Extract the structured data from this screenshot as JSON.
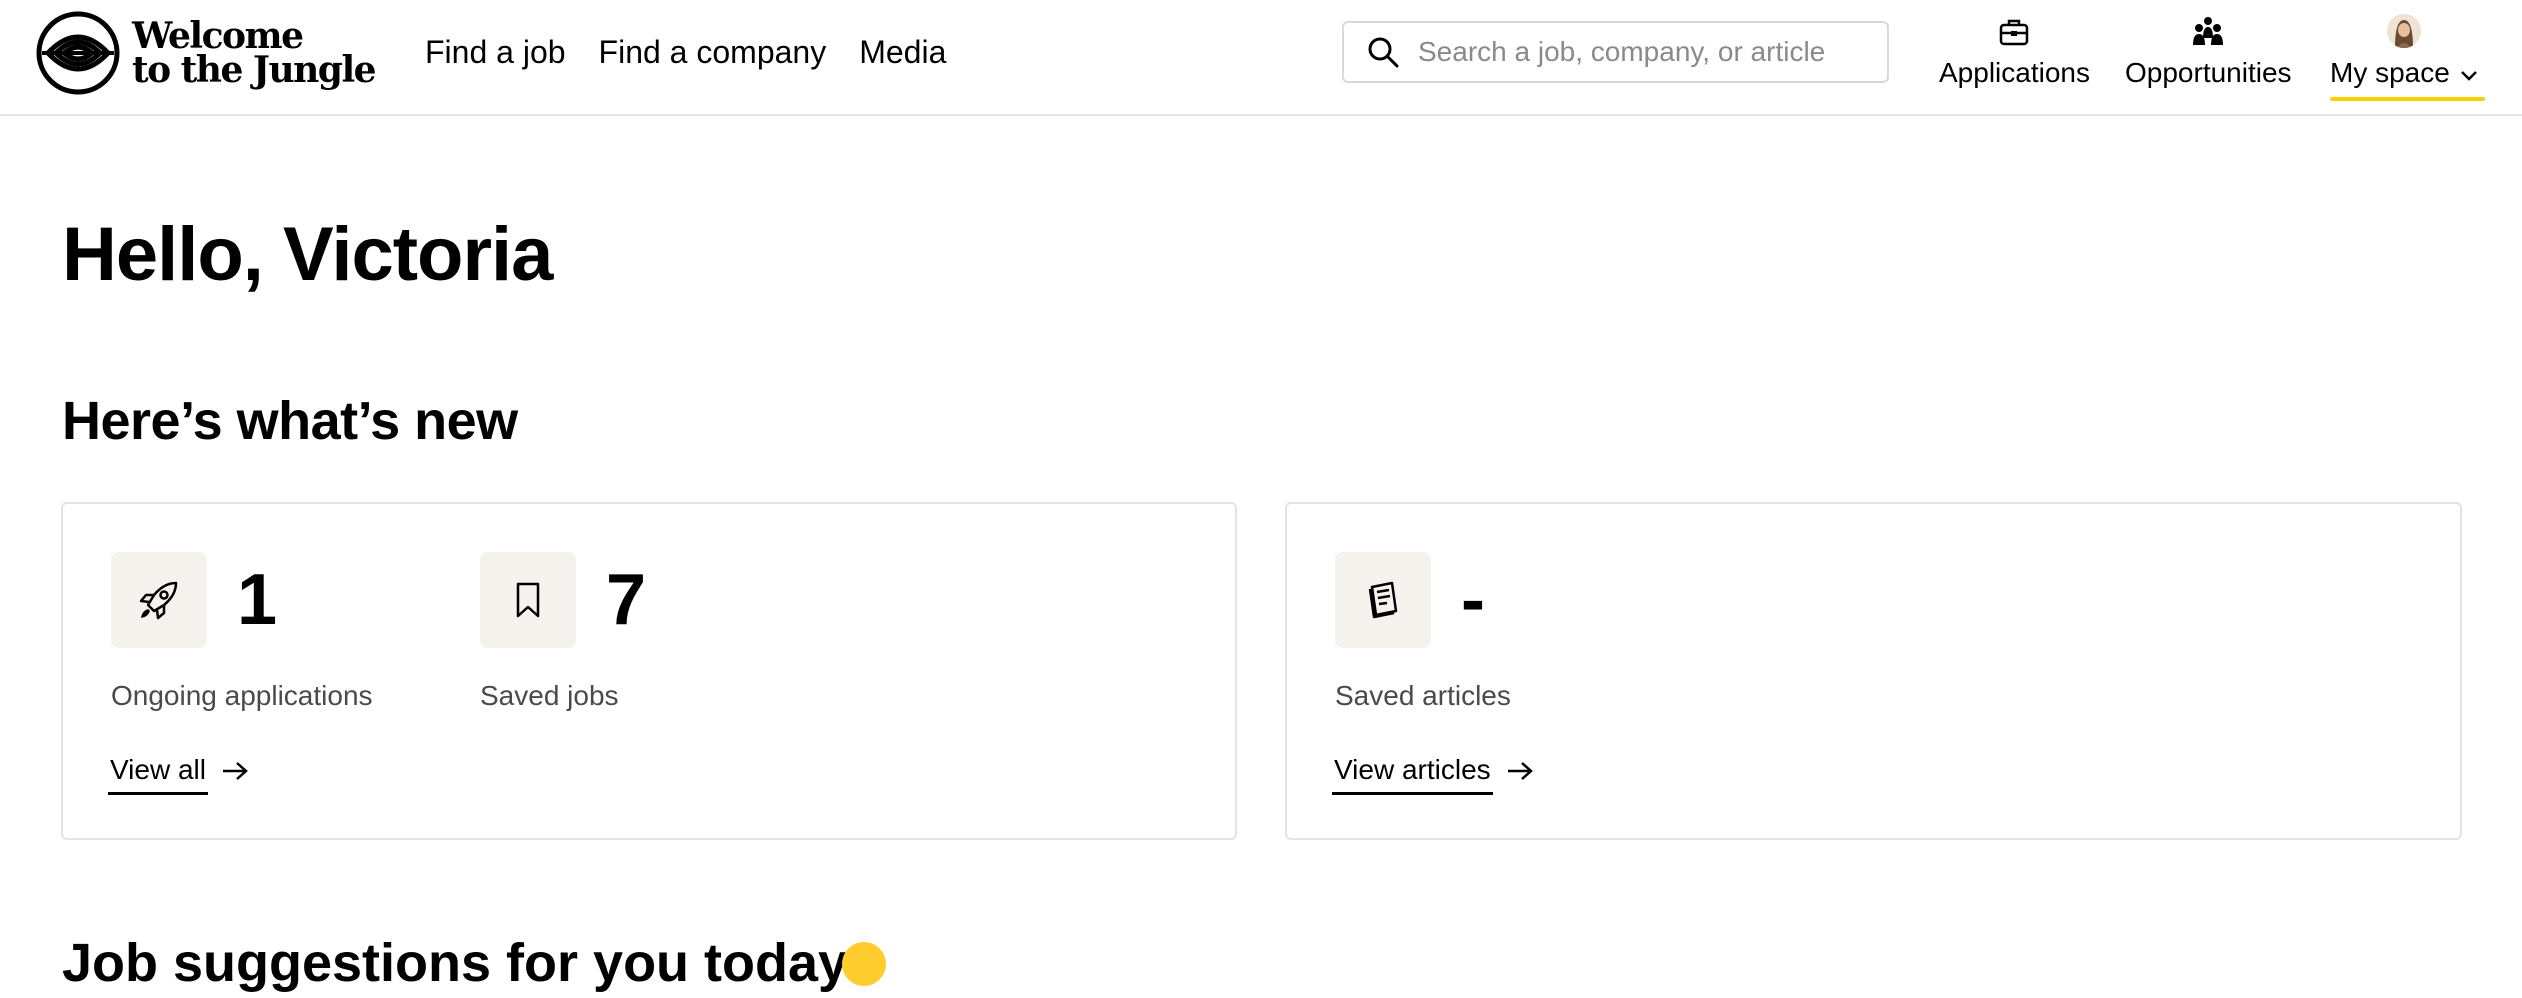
{
  "brand": {
    "logo_line1": "Welcome",
    "logo_line2": "to the Jungle",
    "accent_color": "#ffcd00"
  },
  "nav": {
    "links": [
      "Find a job",
      "Find a company",
      "Media"
    ],
    "search_placeholder": "Search a job, company, or article",
    "applications": "Applications",
    "opportunities": "Opportunities",
    "my_space": "My space"
  },
  "page": {
    "greeting": "Hello, Victoria",
    "section_title": "Here’s what’s new",
    "next_section_title": "Job suggestions for you today"
  },
  "cards": {
    "left": {
      "stats": [
        {
          "icon": "rocket-icon",
          "value": "1",
          "label": "Ongoing applications"
        },
        {
          "icon": "bookmark-icon",
          "value": "7",
          "label": "Saved jobs"
        }
      ],
      "link": "View all"
    },
    "right": {
      "stats": [
        {
          "icon": "notebook-icon",
          "value": "-",
          "label": "Saved articles"
        }
      ],
      "link": "View articles"
    }
  }
}
